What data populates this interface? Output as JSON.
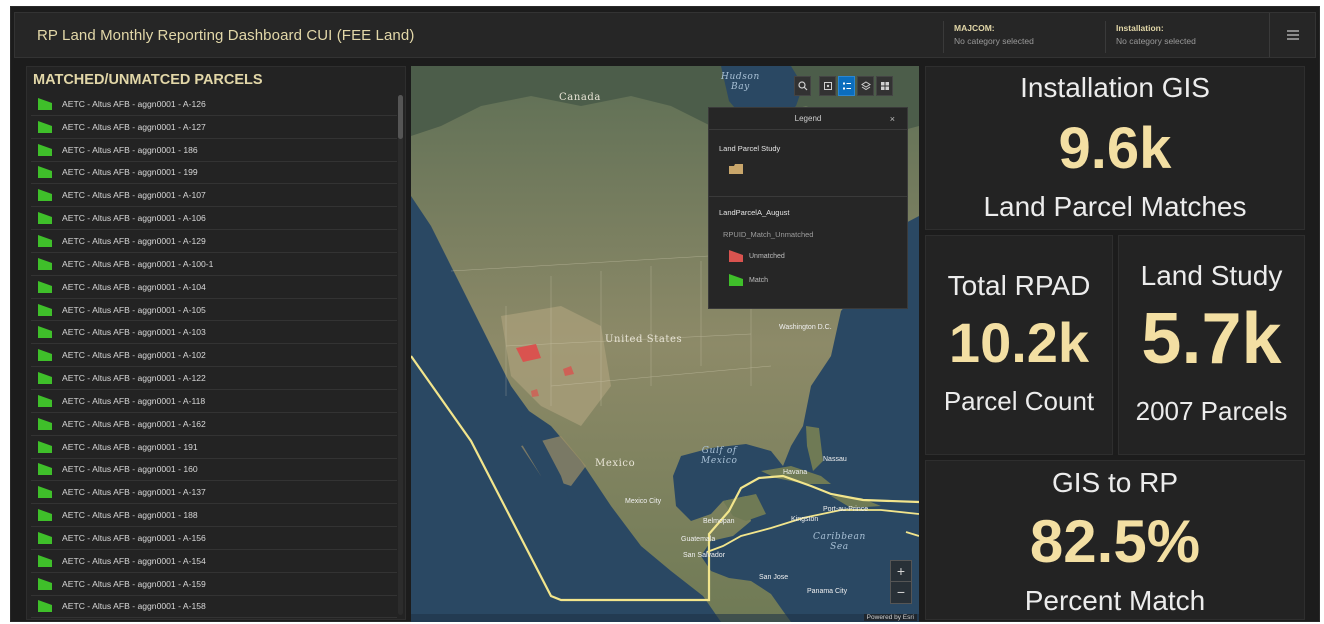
{
  "header": {
    "title": "RP Land Monthly Reporting Dashboard CUI (FEE Land)",
    "filters": [
      {
        "label": "MAJCOM:",
        "value": "No category selected"
      },
      {
        "label": "Installation:",
        "value": "No category selected"
      }
    ],
    "menu_icon": "hamburger-menu-icon"
  },
  "parcel_list": {
    "title": "MATCHED/UNMATCED PARCELS",
    "items": [
      "AETC - Altus AFB - aggn0001 - A-126",
      "AETC - Altus AFB - aggn0001 - A-127",
      "AETC - Altus AFB - aggn0001 - 186",
      "AETC - Altus AFB - aggn0001 - 199",
      "AETC - Altus AFB - aggn0001 - A-107",
      "AETC - Altus AFB - aggn0001 - A-106",
      "AETC - Altus AFB - aggn0001 - A-129",
      "AETC - Altus AFB - aggn0001 - A-100-1",
      "AETC - Altus AFB - aggn0001 - A-104",
      "AETC - Altus AFB - aggn0001 - A-105",
      "AETC - Altus AFB - aggn0001 - A-103",
      "AETC - Altus AFB - aggn0001 - A-102",
      "AETC - Altus AFB - aggn0001 - A-122",
      "AETC - Altus AFB - aggn0001 - A-118",
      "AETC - Altus AFB - aggn0001 - A-162",
      "AETC - Altus AFB - aggn0001 - 191",
      "AETC - Altus AFB - aggn0001 - 160",
      "AETC - Altus AFB - aggn0001 - A-137",
      "AETC - Altus AFB - aggn0001 - 188",
      "AETC - Altus AFB - aggn0001 - A-156",
      "AETC - Altus AFB - aggn0001 - A-154",
      "AETC - Altus AFB - aggn0001 - A-159",
      "AETC - Altus AFB - aggn0001 - A-158"
    ],
    "item_icon": "green-match-flag-icon",
    "match_color": "#3fbf2a"
  },
  "map": {
    "labels": {
      "canada": "Canada",
      "hudson_bay": "Hudson\nBay",
      "united_states": "United States",
      "gulf_of_mexico": "Gulf of\nMexico",
      "mexico": "Mexico",
      "caribbean_sea": "Caribbean\nSea",
      "washington": "Washington D.C.",
      "havana": "Havana",
      "kingston": "Kingston",
      "port_au_prince": "Port-au-Prince",
      "mexico_city": "Mexico City",
      "guatemala": "Guatemala",
      "san_salvador": "San Salvador",
      "san_jose": "San Jose",
      "panama": "Panama City",
      "nassau": "Nassau",
      "belmopan": "Belmopan"
    },
    "tools": [
      "search-icon",
      "zoom-extent-icon",
      "legend-icon",
      "layers-icon",
      "basemap-icon"
    ],
    "zoom_in": "+",
    "zoom_out": "−",
    "attribution": "Powered by Esri",
    "legend": {
      "title": "Legend",
      "close": "×",
      "layer1": "Land Parcel Study",
      "layer2": "LandParcelA_August",
      "field": "RPUID_Match_Unmatched",
      "unmatched_label": "Unmatched",
      "match_label": "Match",
      "study_color": "#c9a66b",
      "unmatched_color": "#d9534f",
      "match_color": "#3fbf2a"
    }
  },
  "stats": {
    "installation_gis": {
      "title": "Installation GIS",
      "value": "9.6k",
      "subtitle": "Land Parcel Matches"
    },
    "total_rpad": {
      "title": "Total RPAD",
      "value": "10.2k",
      "subtitle": "Parcel Count"
    },
    "land_study": {
      "title": "Land Study",
      "value": "5.7k",
      "subtitle": "2007 Parcels"
    },
    "gis_to_rp": {
      "title": "GIS to RP",
      "value": "82.5%",
      "subtitle": "Percent Match"
    },
    "value_color": "#f3dfa3"
  }
}
